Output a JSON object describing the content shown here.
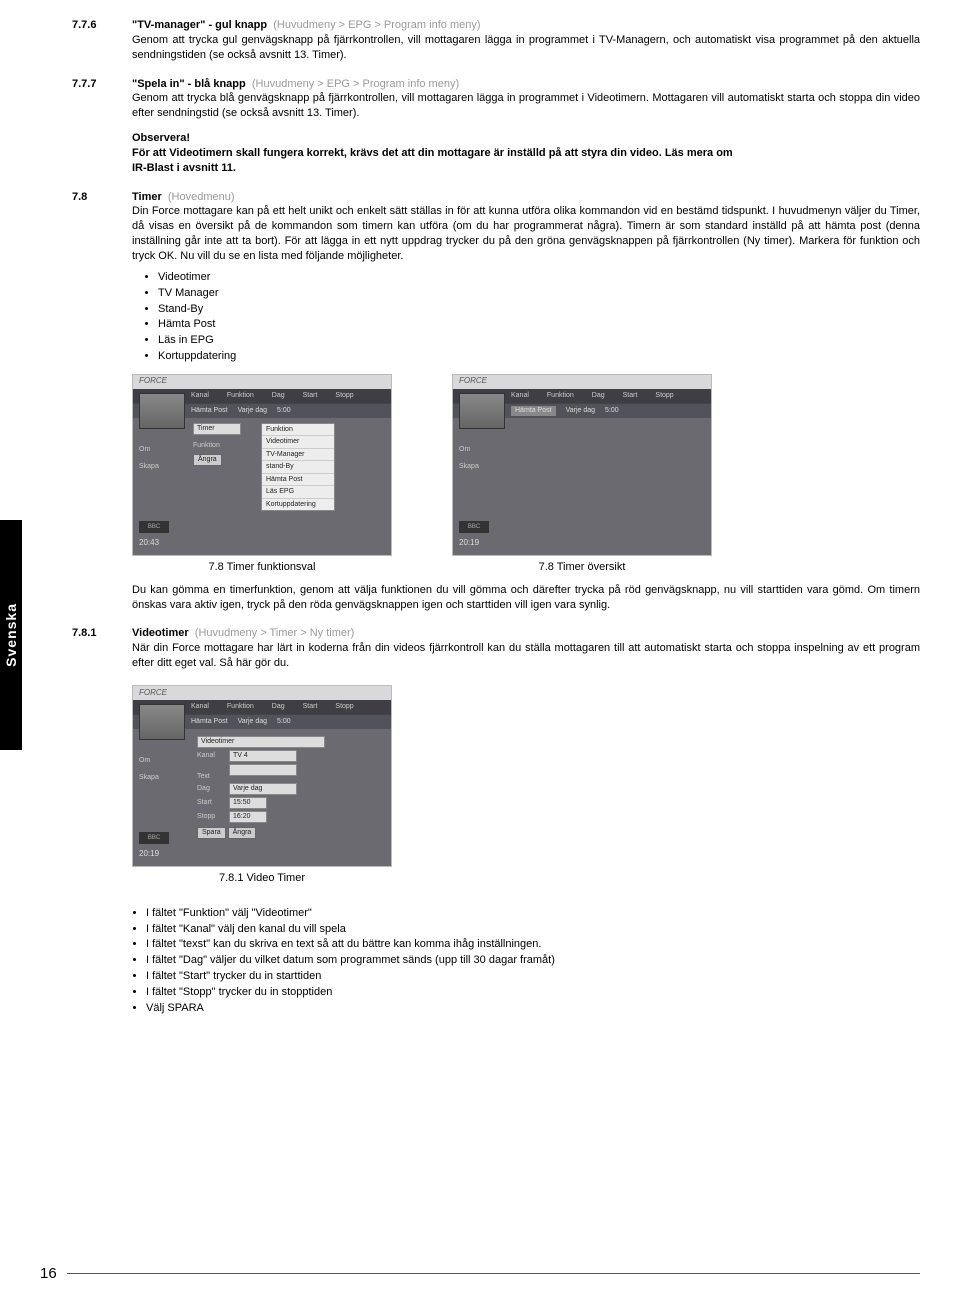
{
  "sideTab": "Svenska",
  "sections": {
    "s776": {
      "num": "7.7.6",
      "title": "\"TV-manager\" - gul knapp",
      "crumb": "(Huvudmeny > EPG > Program info meny)",
      "text": "Genom att trycka gul genvägsknapp på fjärrkontrollen, vill mottagaren lägga in programmet i TV-Managern, och automatiskt visa programmet på den aktuella sendningstiden (se också avsnitt 13. Timer)."
    },
    "s777": {
      "num": "7.7.7",
      "title": "\"Spela in\" - blå knapp",
      "crumb": "(Huvudmeny > EPG > Program info meny)",
      "text": "Genom att trycka blå genvägsknapp på fjärrkontrollen, vill mottagaren lägga in programmet i Videotimern. Mottagaren vill automatiskt starta och stoppa din video efter sendningstid (se också avsnitt 13. Timer).",
      "obsHead": "Observera!",
      "obs1": "För att Videotimern skall fungera korrekt, krävs det att din mottagare är inställd på att styra din video. Läs mera om",
      "obs2": "IR-Blast i avsnitt 11."
    },
    "s78": {
      "num": "7.8",
      "title": "Timer",
      "crumb": "(Hovedmenu)",
      "text": "Din Force mottagare kan på ett helt unikt och enkelt sätt ställas in för att kunna utföra  olika kommandon vid en bestämd tidspunkt. I huvudmenyn väljer du Timer, då visas en översikt på de kommandon som timern kan utföra (om du har programmerat några). Timern är som standard inställd på att hämta post (denna inställning går inte att ta bort). För att lägga in ett nytt uppdrag trycker du på den gröna genvägsknappen på fjärrkontrollen (Ny timer). Markera för funktion och tryck OK. Nu vill du se en lista med följande möjligheter.",
      "bullets": [
        "Videotimer",
        "TV Manager",
        "Stand-By",
        "Hämta  Post",
        "Läs in EPG",
        "Kortuppdatering"
      ],
      "cap1": "7.8 Timer funktionsval",
      "cap2": "7.8 Timer översikt",
      "text2": "Du kan gömma en timerfunktion, genom att välja funktionen du vill gömma och därefter trycka på röd genvägsknapp, nu vill starttiden vara gömd. Om timern önskas vara aktiv igen, tryck på den röda genvägsknappen igen och starttiden vill igen vara synlig."
    },
    "s781": {
      "num": "7.8.1",
      "title": "Videotimer",
      "crumb": "(Huvudmeny > Timer > Ny timer)",
      "text": "När din Force mottagare har lärt in koderna från din videos fjärrkontroll kan du ställa mottagaren till att automatiskt starta och stoppa inspelning av ett program efter ditt eget val. Så här gör du.",
      "cap": "7.8.1 Video Timer",
      "bullets": [
        "I fältet \"Funktion\" välj \"Videotimer\"",
        "I fältet \"Kanal\" välj den kanal du vill spela",
        "I fältet \"texst\" kan du skriva en text så att du bättre kan komma ihåg inställningen.",
        "I fältet \"Dag\" väljer du vilket datum som programmet sänds (upp till 30 dagar framåt)",
        "I fältet \"Start\" trycker du in starttiden",
        "I fältet \"Stopp\" trycker du in stopptiden",
        "Välj SPARA"
      ]
    }
  },
  "shot": {
    "brand": "FORCE",
    "hdr": [
      "Kanal",
      "Funktion",
      "Dag",
      "Start",
      "Stopp"
    ],
    "row": [
      "Hämta Post",
      "Varje dag",
      "5:00"
    ],
    "menu": [
      "Om",
      "Skapa"
    ],
    "bbc": "BBC",
    "t1": "20:43",
    "t2": "20:19",
    "drop": [
      "Funktion",
      "Videotimer",
      "TV-Manager",
      "stand-By",
      "Hämta Post",
      "Läs EPG",
      "Kortuppdatering"
    ],
    "miniTimer": "Timer",
    "miniFunk": "Funktion",
    "miniAngra": "Ångra",
    "vt": {
      "head": "Videotimer",
      "kanal": "Kanal",
      "kanalV": "TV 4",
      "text": "Text",
      "textV": "",
      "dag": "Dag",
      "dagV": "Varje dag",
      "start": "Start",
      "startV": "15:50",
      "stopp": "Stopp",
      "stoppV": "16:20",
      "spara": "Spara",
      "angra": "Ångra"
    }
  },
  "pageNo": "16"
}
